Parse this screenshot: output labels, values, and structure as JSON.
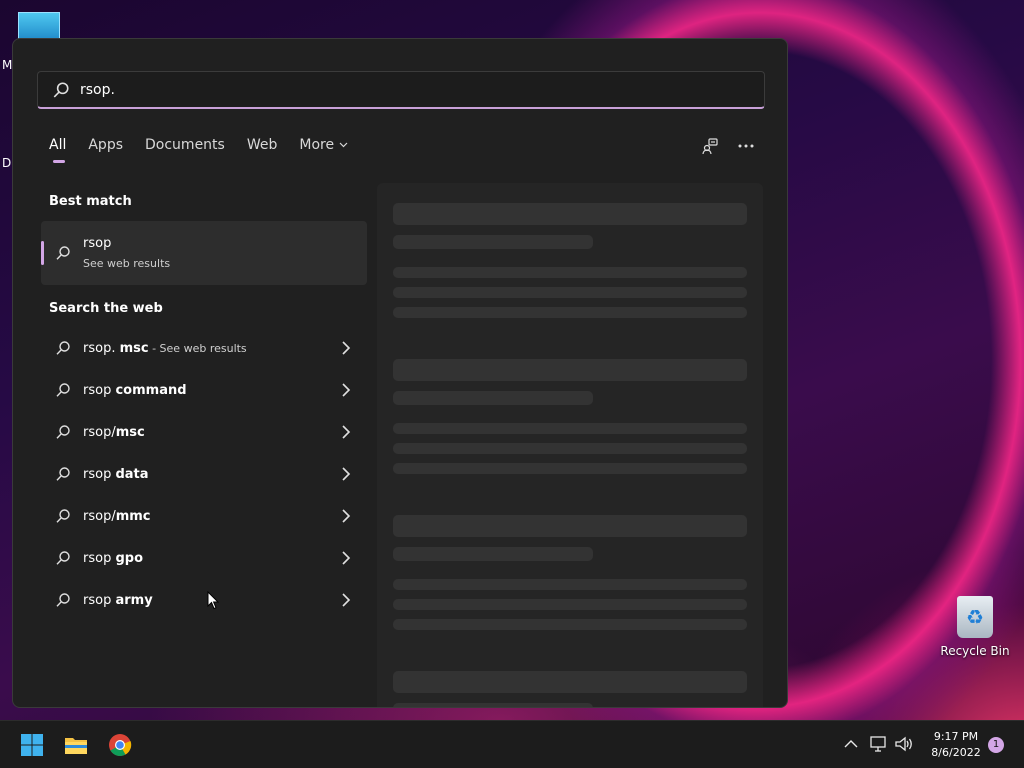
{
  "desktop": {
    "letters": [
      "M",
      "Da"
    ],
    "recycle_bin_label": "Recycle Bin"
  },
  "search": {
    "query": "rsop."
  },
  "filters": [
    {
      "label": "All",
      "active": true
    },
    {
      "label": "Apps"
    },
    {
      "label": "Documents"
    },
    {
      "label": "Web"
    },
    {
      "label": "More"
    }
  ],
  "best_match": {
    "section_title": "Best match",
    "title": "rsop",
    "subtitle": "See web results"
  },
  "web": {
    "section_title": "Search the web",
    "items": [
      {
        "prefix": "rsop. ",
        "bold": "msc",
        "suffix": " - See web results"
      },
      {
        "prefix": "rsop ",
        "bold": "command",
        "suffix": ""
      },
      {
        "prefix": "rsop/",
        "bold": "msc",
        "suffix": ""
      },
      {
        "prefix": "rsop ",
        "bold": "data",
        "suffix": ""
      },
      {
        "prefix": "rsop/",
        "bold": "mmc",
        "suffix": ""
      },
      {
        "prefix": "rsop ",
        "bold": "gpo",
        "suffix": ""
      },
      {
        "prefix": "rsop ",
        "bold": "army",
        "suffix": ""
      }
    ]
  },
  "taskbar": {
    "time": "9:17 PM",
    "date": "8/6/2022",
    "notification_count": "1"
  },
  "colors": {
    "accent": "#d3a6e6",
    "panel_bg": "#202020",
    "placeholder": "#333333"
  }
}
